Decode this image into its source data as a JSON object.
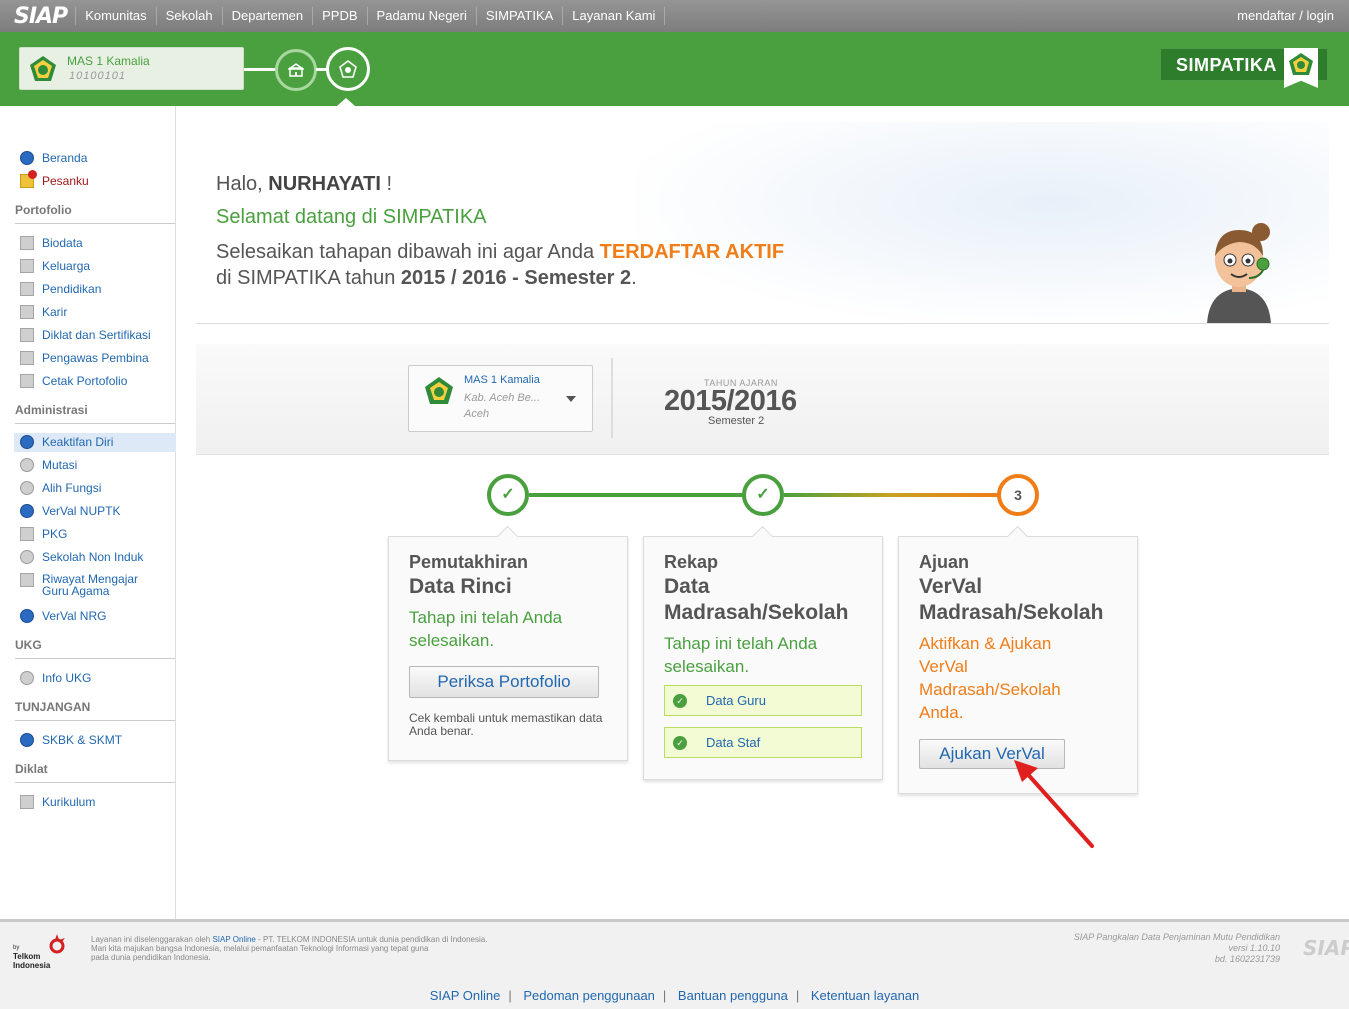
{
  "topnav": {
    "logo": "SIAP",
    "items": [
      "Komunitas",
      "Sekolah",
      "Departemen",
      "PPDB",
      "Padamu Negeri",
      "SIMPATIKA",
      "Layanan Kami"
    ],
    "login": "mendaftar / login"
  },
  "header": {
    "school_name": "MAS 1 Kamalia",
    "school_id": "10100101",
    "brand": "SIMPATIKA"
  },
  "sidebar": {
    "top": [
      {
        "label": "Beranda",
        "icon": "info-icon"
      },
      {
        "label": "Pesanku",
        "icon": "mail-alert-icon"
      }
    ],
    "sections": [
      {
        "title": "Portofolio",
        "items": [
          "Biodata",
          "Keluarga",
          "Pendidikan",
          "Karir",
          "Diklat dan Sertifikasi",
          "Pengawas Pembina",
          "Cetak Portofolio"
        ]
      },
      {
        "title": "Administrasi",
        "items": [
          "Keaktifan Diri",
          "Mutasi",
          "Alih Fungsi",
          "VerVal NUPTK",
          "PKG",
          "Sekolah Non Induk",
          "Riwayat Mengajar Guru Agama",
          "VerVal NRG"
        ]
      },
      {
        "title": "UKG",
        "items": [
          "Info UKG"
        ]
      },
      {
        "title": "TUNJANGAN",
        "items": [
          "SKBK & SKMT"
        ]
      },
      {
        "title": "Diklat",
        "items": [
          "Kurikulum"
        ]
      }
    ],
    "riwayat_line1": "Riwayat Mengajar",
    "riwayat_line2": "Guru Agama",
    "active_item": "Keaktifan Diri"
  },
  "hero": {
    "greeting_prefix": "Halo,",
    "name": "NURHAYATI",
    "greeting_suffix": "!",
    "welcome": "Selamat datang di SIMPATIKA",
    "instr_prefix": "Selesaikan tahapan dibawah ini agar Anda",
    "instr_highlight": "TERDAFTAR AKTIF",
    "instr_line2_prefix": "di SIMPATIKA tahun",
    "instr_year": "2015 / 2016 - Semester 2",
    "instr_end": "."
  },
  "yearbar": {
    "school_name": "MAS 1 Kamalia",
    "school_region": "Kab. Aceh Be...",
    "school_province": "Aceh",
    "label": "TAHUN AJARAN",
    "year": "2015/2016",
    "semester": "Semester 2"
  },
  "steps": [
    {
      "circle": "✓",
      "title1": "Pemutakhiran",
      "title2": "Data Rinci",
      "status": "Tahap ini telah Anda selesaikan.",
      "button": "Periksa Portofolio",
      "note": "Cek kembali untuk memastikan data Anda benar."
    },
    {
      "circle": "✓",
      "title1": "Rekap",
      "title2": "Data",
      "title3": "Madrasah/Sekolah",
      "status": "Tahap ini telah Anda selesaikan.",
      "checks": [
        "Data Guru",
        "Data Staf"
      ]
    },
    {
      "circle": "3",
      "title1": "Ajuan",
      "title2": "VerVal",
      "title3": "Madrasah/Sekolah",
      "status": "Aktifkan & Ajukan VerVal Madrasah/Sekolah Anda.",
      "button": "Ajukan VerVal"
    }
  ],
  "footer": {
    "telkom_by": "by",
    "telkom_name": "Telkom",
    "telkom_country": "Indonesia",
    "text_pre": "Layanan ini diselenggarakan oleh",
    "text_link": "SIAP Online",
    "text_post": "- PT. TELKOM INDONESIA untuk dunia pendidikan di Indonesia.",
    "text_line2": "Mari kita majukan bangsa Indonesia, melalui pemanfaatan Teknologi Informasi yang tepat guna",
    "text_line3": "pada dunia pendidikan Indonesia.",
    "right_line1": "SIAP Pangkalan Data Penjaminan Mutu Pendidikan",
    "right_line2": "versi 1.10.10",
    "right_line3": "bd. 1602231739",
    "right_logo": "SIAP",
    "links": [
      "SIAP Online",
      "Pedoman penggunaan",
      "Bantuan pengguna",
      "Ketentuan layanan"
    ]
  },
  "colors": {
    "green": "#4aa03f",
    "orange": "#f07d17",
    "link_blue": "#2268b0",
    "nav_grey": "#8a8a8a"
  }
}
